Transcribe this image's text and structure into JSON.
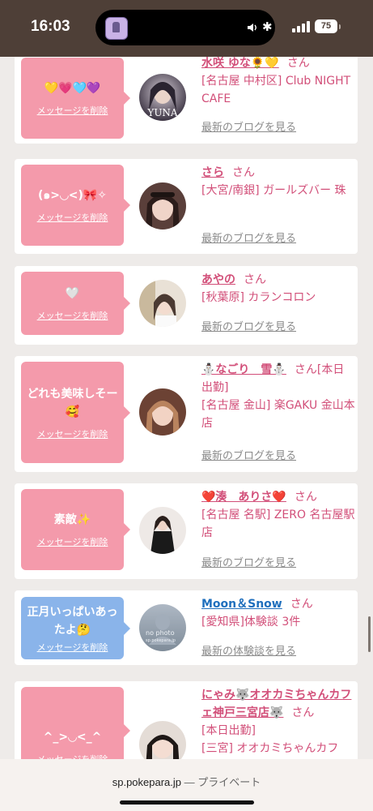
{
  "status": {
    "time": "16:03",
    "battery": "75"
  },
  "cards": [
    {
      "message": "💛💗🩵💜",
      "delete_label": "メッセージを削除",
      "name": "水咲 ゆな🌻💛",
      "suffix": "さん",
      "shop": "[名古屋 中村区] Club NIGHT CAFE",
      "link": "最新のブログを見る",
      "avatar_text": "YUNA"
    },
    {
      "message": "(๑>◡<)🎀✧",
      "delete_label": "メッセージを削除",
      "name": "さら",
      "suffix": "さん",
      "shop": "[大宮/南銀] ガールズバー 珠",
      "link": "最新のブログを見る"
    },
    {
      "message": "🤍",
      "delete_label": "メッセージを削除",
      "name": "あやの",
      "suffix": "さん",
      "shop": "[秋葉原] カランコロン",
      "link": "最新のブログを見る"
    },
    {
      "message": "どれも美味しそー🥰",
      "delete_label": "メッセージを削除",
      "name": "⛄なごり　雪⛄",
      "suffix": "さん[本日出勤]",
      "shop": "[名古屋 金山] 楽GAKU 金山本店",
      "link": "最新のブログを見る"
    },
    {
      "message": "素敵✨",
      "delete_label": "メッセージを削除",
      "name": "❤️湊　ありさ❤️",
      "suffix": "さん",
      "shop": "[名古屋 名駅] ZERO 名古屋駅店",
      "link": "最新のブログを見る"
    },
    {
      "message": "正月いっぱいあったよ🤔",
      "delete_label": "メッセージを削除",
      "name": "Moon＆Snow",
      "suffix": "さん",
      "shop": "[愛知県]体験談 3件",
      "link": "最新の体験談を見る",
      "avatar_text": "no photo",
      "avatar_sub": "sp.pokepara.jp"
    },
    {
      "message": "^_>◡<_^",
      "delete_label": "メッセージを削除",
      "name": "にゃみ🐺オオカミちゃんカフェ神戸三宮店🐺",
      "suffix": "さん",
      "status": "[本日出勤]",
      "shop": "[三宮] オオカミちゃんカフ"
    }
  ],
  "browser": {
    "domain": "sp.pokepara.jp",
    "mode": "— プライベート"
  },
  "colors": {
    "status_bar": "#4e3f37",
    "bubble_pink": "#f49aab",
    "bubble_blue": "#8ab4ea",
    "accent_text": "#d24f79",
    "link_blue": "#1f6fbd"
  }
}
